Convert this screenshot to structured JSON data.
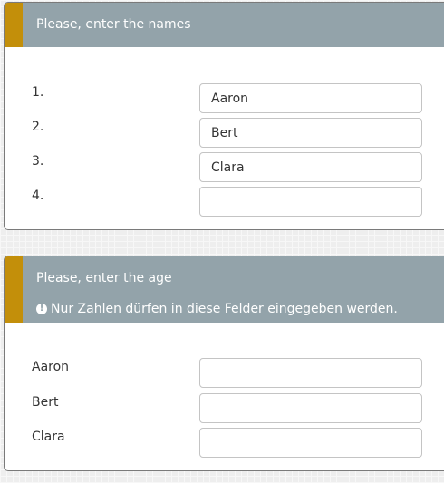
{
  "colors": {
    "accent": "#c38f0a",
    "header_bg": "#93a3aa"
  },
  "names_panel": {
    "title": "Please, enter the names",
    "rows": [
      {
        "label": "1.",
        "value": "Aaron"
      },
      {
        "label": "2.",
        "value": "Bert"
      },
      {
        "label": "3.",
        "value": "Clara"
      },
      {
        "label": "4.",
        "value": ""
      }
    ]
  },
  "age_panel": {
    "title": "Please, enter the age",
    "notice_icon": "exclamation-circle-icon",
    "notice": "Nur Zahlen dürfen in diese Felder eingegeben werden.",
    "rows": [
      {
        "label": "Aaron",
        "value": ""
      },
      {
        "label": "Bert",
        "value": ""
      },
      {
        "label": "Clara",
        "value": ""
      }
    ]
  }
}
